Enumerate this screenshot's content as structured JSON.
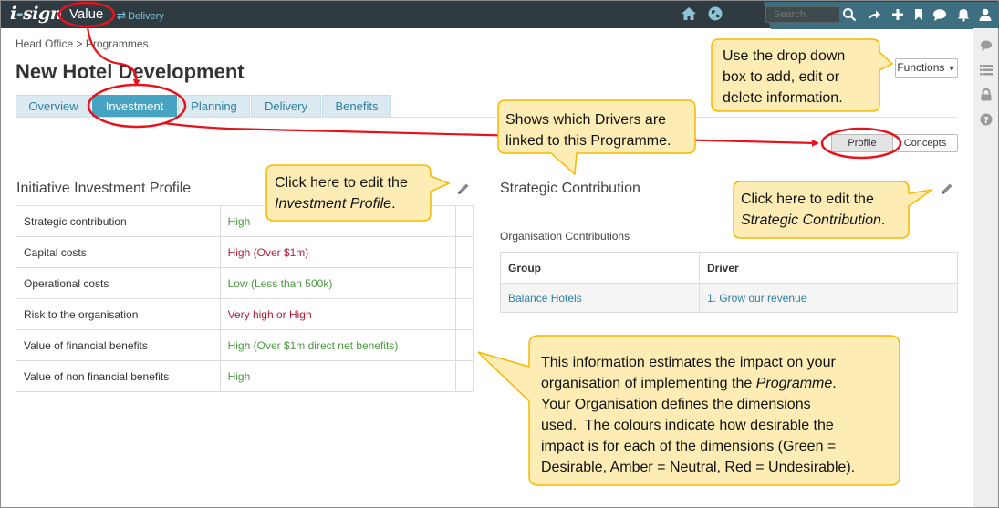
{
  "topbar": {
    "logo_main": "i",
    "logo_hyphen": "-",
    "logo_rest": "sign",
    "value_label": "Value",
    "delivery_label": "Delivery",
    "search_placeholder": "Search"
  },
  "breadcrumb": "Head Office > Programmes",
  "page_title": "New Hotel Development",
  "tabs": [
    {
      "label": "Overview",
      "active": false
    },
    {
      "label": "Investment",
      "active": true
    },
    {
      "label": "Planning",
      "active": false
    },
    {
      "label": "Delivery",
      "active": false
    },
    {
      "label": "Benefits",
      "active": false
    }
  ],
  "functions_label": "Functions",
  "view_toggle": {
    "profile": "Profile",
    "concepts": "Concepts"
  },
  "investment_profile": {
    "title": "Initiative Investment Profile",
    "rows": [
      {
        "label": "Strategic contribution",
        "value": "High",
        "status": "good"
      },
      {
        "label": "Capital costs",
        "value": "High (Over $1m)",
        "status": "bad"
      },
      {
        "label": "Operational costs",
        "value": "Low (Less than 500k)",
        "status": "good"
      },
      {
        "label": "Risk to the organisation",
        "value": "Very high or High",
        "status": "bad"
      },
      {
        "label": "Value of financial benefits",
        "value": "High (Over $1m direct net benefits)",
        "status": "good"
      },
      {
        "label": "Value of non financial benefits",
        "value": "High",
        "status": "good"
      }
    ]
  },
  "strategic_contribution": {
    "title": "Strategic Contribution",
    "subtitle": "Organisation Contributions",
    "columns": [
      "Group",
      "Driver"
    ],
    "rows": [
      {
        "group": "Balance Hotels",
        "driver": "1. Grow our revenue"
      }
    ]
  },
  "callouts": {
    "functions": [
      "Use the drop down",
      "box to add, edit or",
      "delete information."
    ],
    "drivers": [
      "Shows which Drivers are",
      "linked to this Programme."
    ],
    "edit_investment": {
      "line1": "Click here to edit the",
      "line2": "Investment Profile",
      "end": "."
    },
    "edit_strategic": {
      "line1": "Click here to edit the",
      "line2": "Strategic Contribution",
      "end": "."
    },
    "info": {
      "l1": "This information estimates the impact on your",
      "l2a": "organisation of implementing the ",
      "l2b": "Programme",
      "l2c": ".",
      "l3": "Your Organisation defines the dimensions",
      "l4": "used.  The colours indicate how desirable the",
      "l5": "impact is for each of the dimensions (Green =",
      "l6": "Desirable, Amber = Neutral, Red = Undesirable)."
    }
  },
  "colors": {
    "topbar": "#2f3b40",
    "accent": "#47a3c2",
    "good": "#4a9a3e",
    "bad": "#b01e3a",
    "callout_fill": "#fdedb4",
    "callout_border": "#f5b800",
    "annotation_red": "#e8121c"
  },
  "icons": [
    "home-icon",
    "globe-icon",
    "search-icon",
    "share-icon",
    "plus-icon",
    "bookmark-icon",
    "chat-icon",
    "bell-icon",
    "user-icon",
    "comment-icon",
    "list-icon",
    "lock-icon",
    "help-icon",
    "pencil-icon"
  ]
}
